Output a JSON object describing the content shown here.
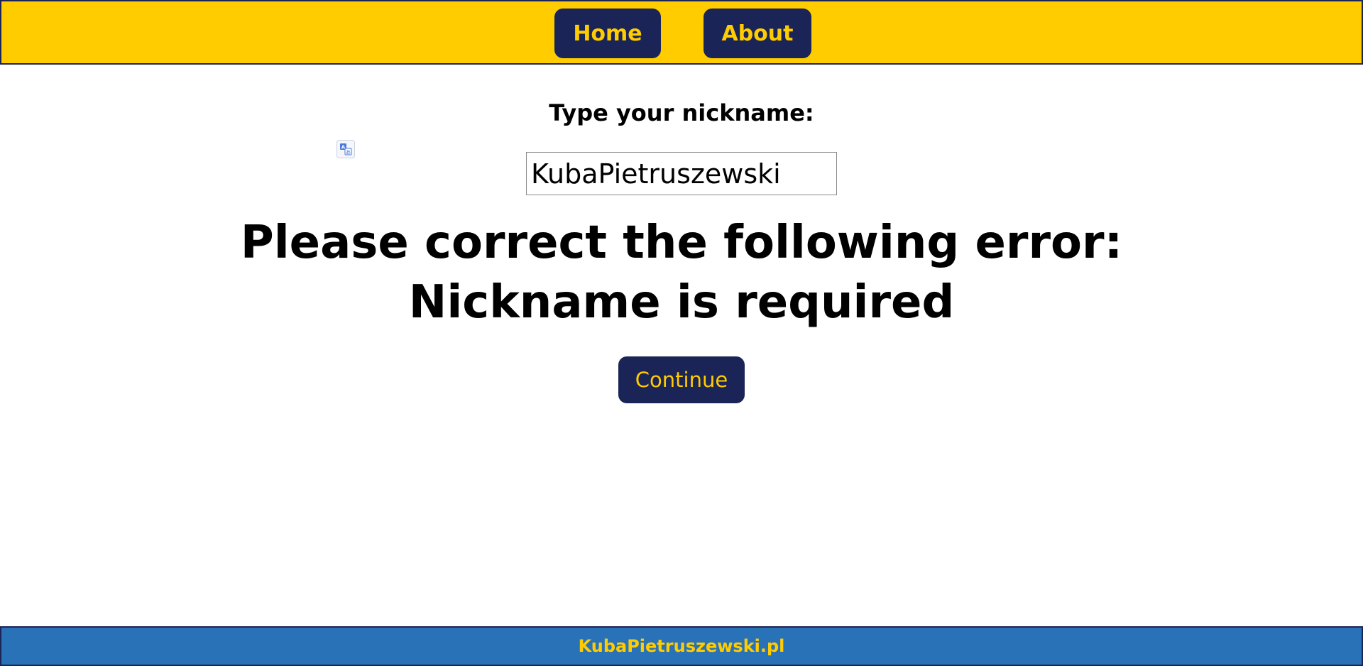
{
  "colors": {
    "header_bg": "#ffcc00",
    "button_bg": "#1a2456",
    "button_text": "#ffcc00",
    "footer_bg": "#2a72b8"
  },
  "nav": {
    "home_label": "Home",
    "about_label": "About"
  },
  "form": {
    "prompt": "Type your nickname:",
    "nickname_value": "KubaPietruszewski",
    "translate_icon": "translate-icon"
  },
  "error": {
    "heading": "Please correct the following error:",
    "message": "Nickname is required"
  },
  "actions": {
    "continue_label": "Continue"
  },
  "footer": {
    "site_link": "KubaPietruszewski.pl"
  }
}
